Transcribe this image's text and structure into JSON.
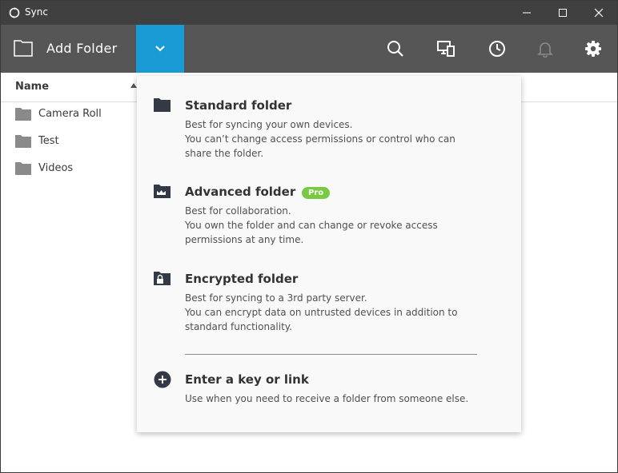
{
  "window": {
    "title": "Sync"
  },
  "toolbar": {
    "add_folder_label": "Add Folder",
    "icons": [
      "search-icon",
      "devices-icon",
      "history-icon",
      "bell-icon",
      "gear-icon"
    ],
    "accent": "#1a9bd6"
  },
  "list": {
    "column_name": "Name",
    "items": [
      {
        "name": "Camera Roll"
      },
      {
        "name": "Test"
      },
      {
        "name": "Videos"
      }
    ]
  },
  "menu": {
    "standard": {
      "title": "Standard folder",
      "desc1": "Best for syncing your own devices.",
      "desc2": "You can’t change access permissions or control who can",
      "desc3": "share the folder."
    },
    "advanced": {
      "title": "Advanced folder",
      "badge": "Pro",
      "desc1": "Best for collaboration.",
      "desc2": "You own the folder and can change or revoke access",
      "desc3": "permissions at any time."
    },
    "encrypted": {
      "title": "Encrypted folder",
      "desc1": "Best for syncing to a 3rd party server.",
      "desc2": "You can encrypt data on untrusted devices in addition to",
      "desc3": "standard functionality."
    },
    "key": {
      "title": "Enter a key or link",
      "desc1": "Use when you need to receive a folder from someone else."
    }
  }
}
